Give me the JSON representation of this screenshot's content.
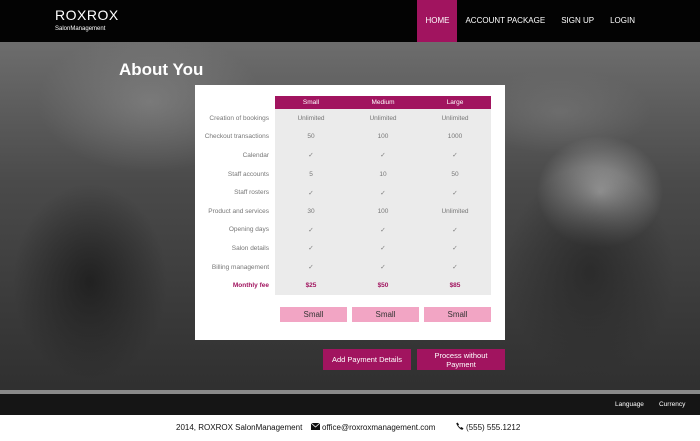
{
  "brand": {
    "title": "ROXROX",
    "subtitle": "SalonManagement"
  },
  "nav": {
    "items": [
      "HOME",
      "ACCOUNT PACKAGE",
      "SIGN UP",
      "LOGIN"
    ]
  },
  "page_title": "About You",
  "plans": [
    "Small",
    "Medium",
    "Large"
  ],
  "features": [
    {
      "name": "Creation of bookings",
      "values": [
        "Unlimited",
        "Unlimited",
        "Unlimited"
      ]
    },
    {
      "name": "Checkout transactions",
      "values": [
        "50",
        "100",
        "1000"
      ]
    },
    {
      "name": "Calendar",
      "values": [
        "✓",
        "✓",
        "✓"
      ]
    },
    {
      "name": "Staff accounts",
      "values": [
        "5",
        "10",
        "50"
      ]
    },
    {
      "name": "Staff rosters",
      "values": [
        "✓",
        "✓",
        "✓"
      ]
    },
    {
      "name": "Product and services",
      "values": [
        "30",
        "100",
        "Unlimited"
      ]
    },
    {
      "name": "Opening days",
      "values": [
        "✓",
        "✓",
        "✓"
      ]
    },
    {
      "name": "Salon details",
      "values": [
        "✓",
        "✓",
        "✓"
      ]
    },
    {
      "name": "Billing management",
      "values": [
        "✓",
        "✓",
        "✓"
      ]
    }
  ],
  "monthly_fee": {
    "label": "Monthly fee",
    "values": [
      "$25",
      "$50",
      "$85"
    ]
  },
  "select_buttons": [
    "Small",
    "Small",
    "Small"
  ],
  "actions": {
    "add_payment": "Add Payment Details",
    "process_line1": "Process without",
    "process_line2": "Payment"
  },
  "footer": {
    "language": "Language",
    "currency": "Currency",
    "copyright": "2014, ROXROX SalonManagement",
    "email": "office@roxroxmanagement.com",
    "phone": "(555) 555.1212"
  },
  "colors": {
    "accent": "#a1145f",
    "select_button": "#f2a5c4",
    "nav_bg": "#030303",
    "footer_bg": "#151515"
  },
  "icons": {
    "email": "envelope-icon",
    "phone": "phone-icon"
  }
}
